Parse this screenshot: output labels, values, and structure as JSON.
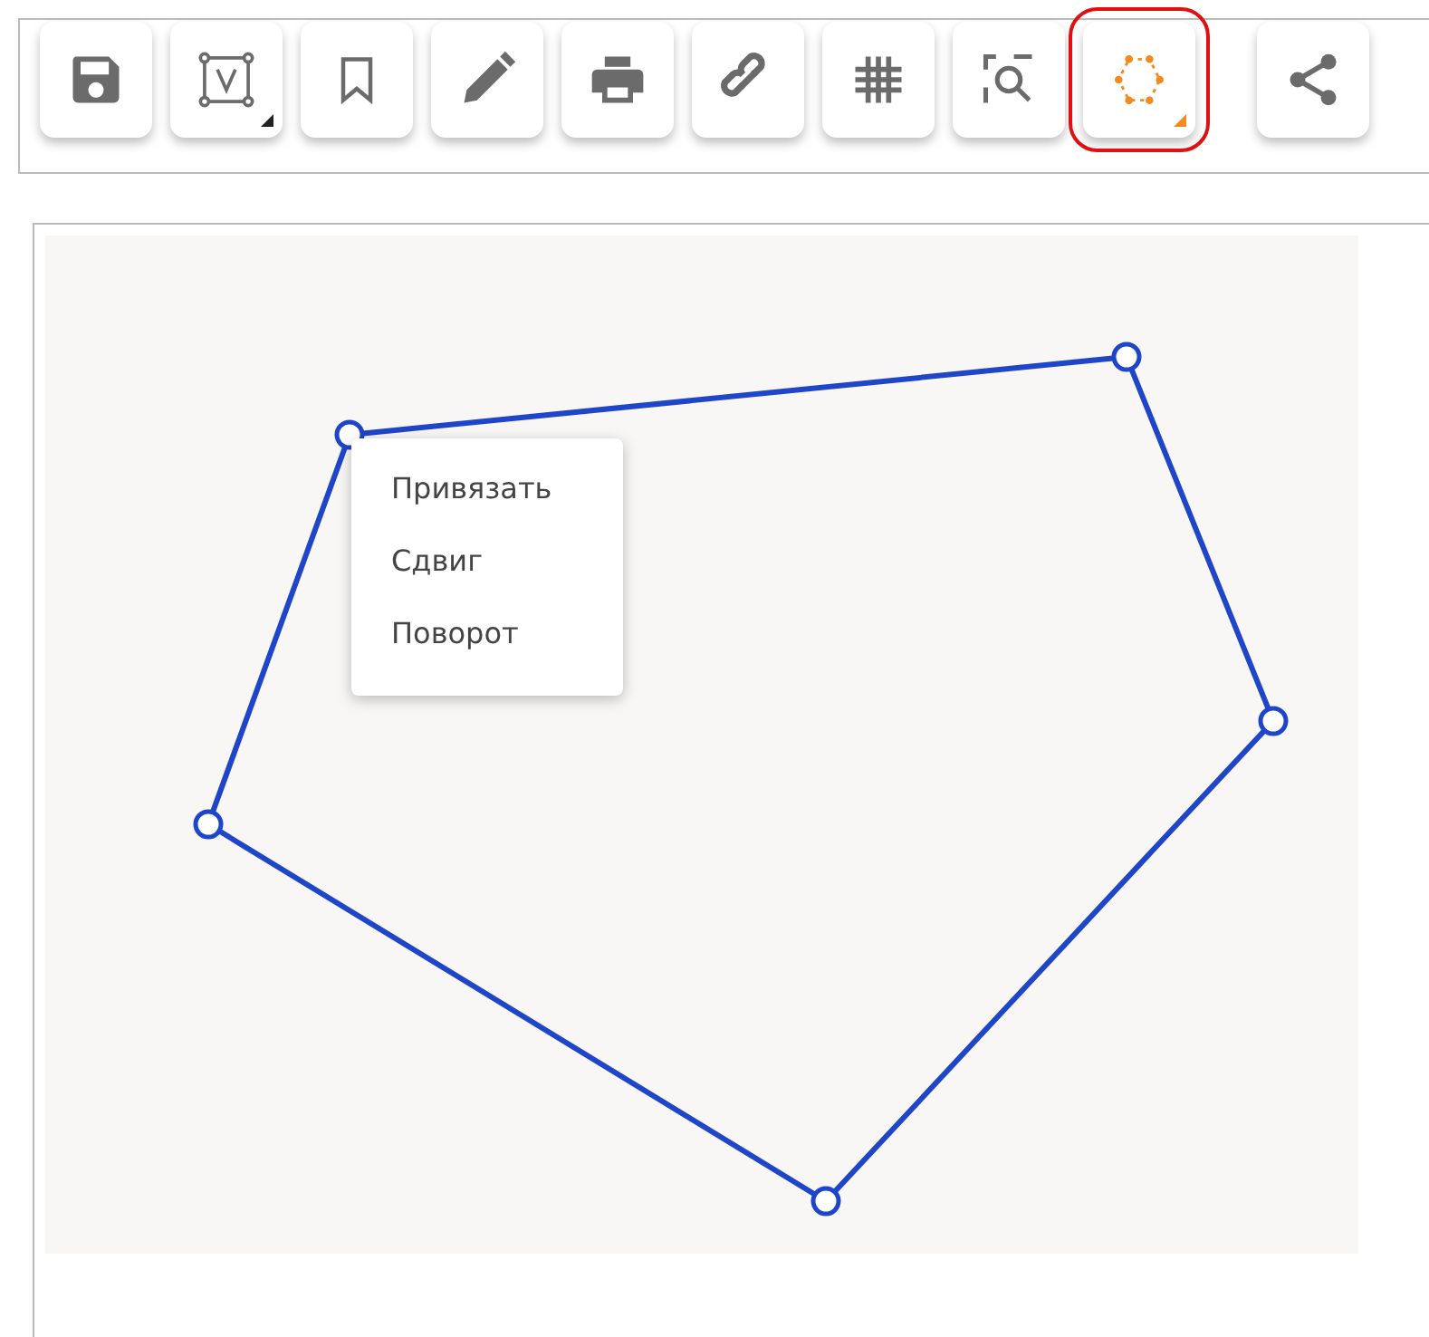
{
  "toolbar": {
    "tools": [
      {
        "selected": false,
        "has_menu": false
      },
      {
        "selected": false,
        "has_menu": true
      },
      {
        "selected": false,
        "has_menu": false
      },
      {
        "selected": false,
        "has_menu": false
      },
      {
        "selected": false,
        "has_menu": false
      },
      {
        "selected": false,
        "has_menu": false
      },
      {
        "selected": false,
        "has_menu": false
      },
      {
        "selected": false,
        "has_menu": false
      },
      {
        "selected": true,
        "has_menu": true
      }
    ],
    "extra": [
      {
        "selected": false,
        "has_menu": false
      }
    ]
  },
  "context_menu": {
    "items": [
      {
        "label": "Привязать"
      },
      {
        "label": "Сдвиг"
      },
      {
        "label": "Поворот"
      }
    ]
  }
}
